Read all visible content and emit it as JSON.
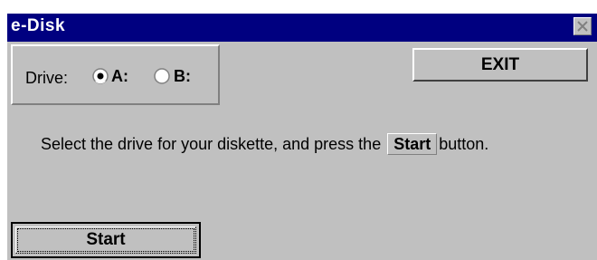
{
  "window": {
    "title": "e-Disk"
  },
  "drive_group": {
    "label": "Drive:",
    "options": [
      {
        "label": "A:",
        "selected": true
      },
      {
        "label": "B:",
        "selected": false
      }
    ]
  },
  "buttons": {
    "exit_label": "EXIT",
    "start_label": "Start"
  },
  "instruction": {
    "before": "Select the drive for your diskette, and press the",
    "inline_button": "Start",
    "after": "button."
  },
  "colors": {
    "titlebar": "#000080",
    "window_face": "#c0c0c0"
  },
  "icons": {
    "close": "close-icon"
  }
}
